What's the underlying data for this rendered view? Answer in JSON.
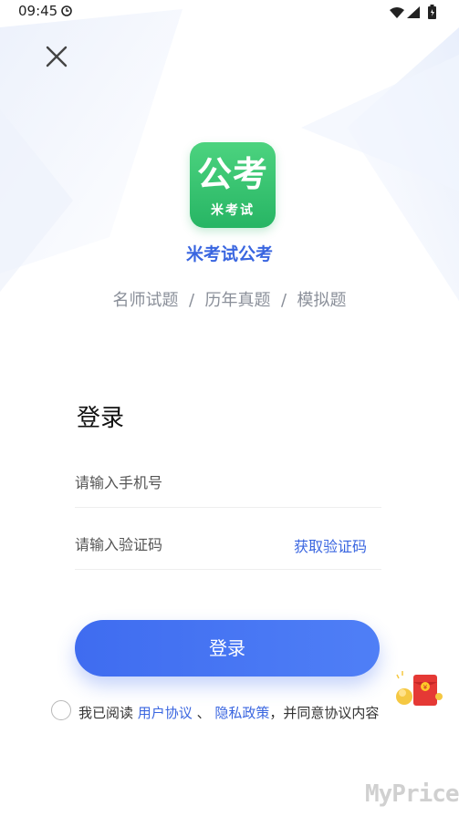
{
  "status_bar": {
    "time": "09:45",
    "icons": [
      "clock-icon",
      "wifi-icon",
      "signal-icon",
      "battery-icon"
    ]
  },
  "header": {
    "close_icon": "close-icon"
  },
  "brand": {
    "logo_title": "公考",
    "logo_subtitle": "米考试",
    "app_name": "米考试公考",
    "tagline": "名师试题  /  历年真题  /  模拟题",
    "colors": {
      "logo_green": "#2fbf6c",
      "accent_blue": "#3a66e0"
    }
  },
  "login": {
    "title": "登录",
    "phone_placeholder": "请输入手机号",
    "phone_value": "",
    "code_placeholder": "请输入验证码",
    "code_value": "",
    "get_code_label": "获取验证码",
    "submit_label": "登录"
  },
  "agreement": {
    "checked": false,
    "prefix": "我已阅读",
    "user_agreement": "用户协议",
    "separator": "、",
    "privacy_policy": "隐私政策",
    "suffix": "，并同意协议内容"
  },
  "floating": {
    "icon": "red-packet-icon"
  },
  "watermark": "MyPrice"
}
